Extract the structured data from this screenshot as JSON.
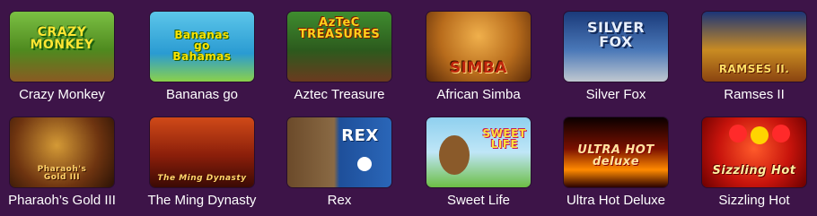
{
  "games": [
    {
      "title": "Crazy Monkey",
      "logo": "CRAZY\nMONKEY",
      "theme": "crazy",
      "icon": "monkey-icon"
    },
    {
      "title": "Bananas go",
      "logo": "Bananas\ngo\nBahamas",
      "theme": "bananas",
      "icon": "banana-icon"
    },
    {
      "title": "Aztec Treasure",
      "logo": "AzTeC\nTREASURES",
      "theme": "aztec",
      "icon": "aztec-icon"
    },
    {
      "title": "African Simba",
      "logo": "SIMBA",
      "theme": "simba",
      "icon": "lion-icon"
    },
    {
      "title": "Silver Fox",
      "logo": "SILVER\nFOX",
      "theme": "fox",
      "icon": "fox-icon"
    },
    {
      "title": "Ramses II",
      "logo": "RAMSES II.",
      "theme": "ramses",
      "icon": "pharaoh-icon"
    },
    {
      "title": "Pharaoh’s Gold III",
      "logo": "Pharaoh's\nGold III",
      "theme": "pharaoh",
      "icon": "pharaoh-mask-icon"
    },
    {
      "title": "The Ming Dynasty",
      "logo": "The Ming Dynasty",
      "theme": "ming",
      "icon": "warrior-icon"
    },
    {
      "title": "Rex",
      "logo": "REX",
      "theme": "rex",
      "icon": "dog-icon"
    },
    {
      "title": "Sweet Life",
      "logo": "SWEET\nLIFE",
      "theme": "sweet",
      "icon": "bear-icon"
    },
    {
      "title": "Ultra Hot Deluxe",
      "logo": "ULTRA HOT deluxe",
      "theme": "ultra",
      "icon": "flame-icon"
    },
    {
      "title": "Sizzling Hot",
      "logo": "Sizzling Hot",
      "theme": "sizzling",
      "icon": "cherry-icon"
    }
  ],
  "colors": {
    "background": "#3d1448",
    "title_text": "#ffffff"
  }
}
